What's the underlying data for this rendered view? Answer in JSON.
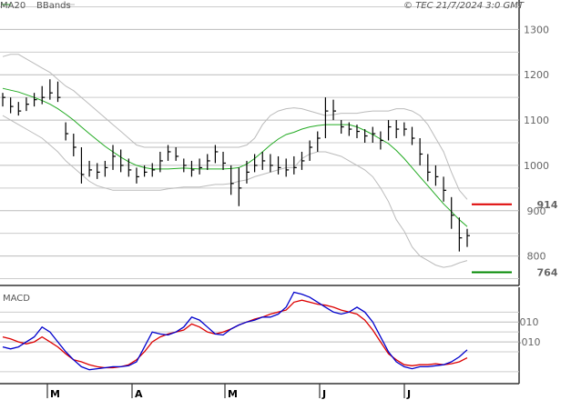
{
  "header": {
    "legend": [
      {
        "label": "MA20",
        "color": "#22aa22"
      },
      {
        "label": "BBands",
        "color": "#bbbbbb"
      }
    ],
    "copyright": "© TEC 21/7/2024 3:0 GMT"
  },
  "chart_data": [
    {
      "type": "line",
      "title": "",
      "ylim": [
        735,
        1365
      ],
      "yticks": [
        800,
        900,
        1000,
        1100,
        1200,
        1300
      ],
      "grid": true,
      "x_months": [
        "M",
        "A",
        "M",
        "J",
        "J"
      ],
      "levels": [
        {
          "label": "914",
          "value": 914,
          "color": "#dd0000"
        },
        {
          "label": "764",
          "value": 764,
          "color": "#008800"
        }
      ],
      "series": [
        {
          "name": "MA20",
          "color": "#22aa22",
          "values": [
            1170,
            1166,
            1162,
            1156,
            1150,
            1143,
            1135,
            1125,
            1113,
            1100,
            1085,
            1070,
            1056,
            1042,
            1030,
            1018,
            1008,
            1000,
            995,
            992,
            992,
            992,
            993,
            994,
            993,
            992,
            992,
            992,
            992,
            993,
            995,
            1003,
            1015,
            1030,
            1045,
            1058,
            1068,
            1073,
            1080,
            1085,
            1088,
            1090,
            1090,
            1090,
            1090,
            1085,
            1077,
            1068,
            1058,
            1048,
            1033,
            1015,
            995,
            975,
            955,
            935,
            915,
            898,
            880,
            865
          ]
        },
        {
          "name": "BBands",
          "color": "#bbbbbb",
          "values": [
            1240,
            1245,
            1245,
            1235,
            1225,
            1215,
            1205,
            1190,
            1175,
            1165,
            1150,
            1135,
            1120,
            1105,
            1090,
            1075,
            1060,
            1045,
            1040,
            1040,
            1040,
            1040,
            1040,
            1040,
            1040,
            1040,
            1040,
            1040,
            1040,
            1040,
            1040,
            1045,
            1060,
            1090,
            1110,
            1120,
            1125,
            1127,
            1125,
            1120,
            1115,
            1110,
            1112,
            1115,
            1115,
            1115,
            1118,
            1120,
            1120,
            1120,
            1125,
            1125,
            1120,
            1110,
            1090,
            1060,
            1030,
            985,
            945,
            925
          ]
        },
        {
          "values": [
            1110,
            1100,
            1090,
            1080,
            1070,
            1060,
            1045,
            1030,
            1010,
            995,
            980,
            965,
            955,
            950,
            945,
            945,
            945,
            945,
            945,
            945,
            945,
            948,
            950,
            952,
            952,
            952,
            955,
            958,
            958,
            960,
            965,
            968,
            975,
            980,
            985,
            990,
            995,
            995,
            1015,
            1025,
            1030,
            1030,
            1025,
            1020,
            1010,
            1000,
            990,
            975,
            950,
            920,
            880,
            855,
            820,
            800,
            790,
            780,
            775,
            778,
            785,
            790
          ]
        }
      ],
      "price_bars": [
        {
          "h": 1160,
          "l": 1130,
          "c": 1150
        },
        {
          "h": 1150,
          "l": 1115,
          "c": 1130
        },
        {
          "h": 1140,
          "l": 1110,
          "c": 1120
        },
        {
          "h": 1150,
          "l": 1120,
          "c": 1135
        },
        {
          "h": 1160,
          "l": 1130,
          "c": 1145
        },
        {
          "h": 1175,
          "l": 1135,
          "c": 1150
        },
        {
          "h": 1190,
          "l": 1145,
          "c": 1160
        },
        {
          "h": 1185,
          "l": 1140,
          "c": 1150
        },
        {
          "h": 1095,
          "l": 1055,
          "c": 1070
        },
        {
          "h": 1070,
          "l": 1020,
          "c": 1040
        },
        {
          "h": 1040,
          "l": 960,
          "c": 980
        },
        {
          "h": 1010,
          "l": 975,
          "c": 990
        },
        {
          "h": 1005,
          "l": 970,
          "c": 985
        },
        {
          "h": 1010,
          "l": 975,
          "c": 995
        },
        {
          "h": 1045,
          "l": 990,
          "c": 1020
        },
        {
          "h": 1035,
          "l": 985,
          "c": 1000
        },
        {
          "h": 1015,
          "l": 975,
          "c": 990
        },
        {
          "h": 995,
          "l": 960,
          "c": 975
        },
        {
          "h": 1000,
          "l": 975,
          "c": 985
        },
        {
          "h": 1005,
          "l": 975,
          "c": 990
        },
        {
          "h": 1030,
          "l": 985,
          "c": 1010
        },
        {
          "h": 1045,
          "l": 1010,
          "c": 1030
        },
        {
          "h": 1040,
          "l": 1010,
          "c": 1020
        },
        {
          "h": 1015,
          "l": 985,
          "c": 1000
        },
        {
          "h": 1010,
          "l": 975,
          "c": 990
        },
        {
          "h": 1015,
          "l": 980,
          "c": 995
        },
        {
          "h": 1025,
          "l": 990,
          "c": 1010
        },
        {
          "h": 1045,
          "l": 1005,
          "c": 1030
        },
        {
          "h": 1030,
          "l": 990,
          "c": 1005
        },
        {
          "h": 1000,
          "l": 935,
          "c": 960
        },
        {
          "h": 995,
          "l": 910,
          "c": 950
        },
        {
          "h": 1010,
          "l": 960,
          "c": 985
        },
        {
          "h": 1025,
          "l": 985,
          "c": 1000
        },
        {
          "h": 1030,
          "l": 990,
          "c": 1010
        },
        {
          "h": 1025,
          "l": 985,
          "c": 1000
        },
        {
          "h": 1020,
          "l": 980,
          "c": 995
        },
        {
          "h": 1015,
          "l": 975,
          "c": 990
        },
        {
          "h": 1020,
          "l": 980,
          "c": 995
        },
        {
          "h": 1030,
          "l": 990,
          "c": 1010
        },
        {
          "h": 1055,
          "l": 1010,
          "c": 1040
        },
        {
          "h": 1075,
          "l": 1030,
          "c": 1060
        },
        {
          "h": 1150,
          "l": 1060,
          "c": 1120
        },
        {
          "h": 1145,
          "l": 1100,
          "c": 1120
        },
        {
          "h": 1100,
          "l": 1070,
          "c": 1085
        },
        {
          "h": 1095,
          "l": 1065,
          "c": 1080
        },
        {
          "h": 1090,
          "l": 1060,
          "c": 1075
        },
        {
          "h": 1080,
          "l": 1050,
          "c": 1065
        },
        {
          "h": 1085,
          "l": 1050,
          "c": 1070
        },
        {
          "h": 1075,
          "l": 1035,
          "c": 1055
        },
        {
          "h": 1100,
          "l": 1055,
          "c": 1085
        },
        {
          "h": 1100,
          "l": 1060,
          "c": 1080
        },
        {
          "h": 1095,
          "l": 1065,
          "c": 1080
        },
        {
          "h": 1085,
          "l": 1045,
          "c": 1060
        },
        {
          "h": 1060,
          "l": 1000,
          "c": 1025
        },
        {
          "h": 1025,
          "l": 965,
          "c": 985
        },
        {
          "h": 1000,
          "l": 955,
          "c": 975
        },
        {
          "h": 975,
          "l": 920,
          "c": 945
        },
        {
          "h": 930,
          "l": 860,
          "c": 890
        },
        {
          "h": 885,
          "l": 810,
          "c": 840
        },
        {
          "h": 860,
          "l": 820,
          "c": 845
        }
      ]
    },
    {
      "type": "line",
      "title": "MACD",
      "ylim": [
        -52,
        45
      ],
      "yticks": [
        10,
        -10
      ],
      "ytick_labels": [
        "010",
        "-010"
      ],
      "grid": true,
      "series": [
        {
          "name": "MACD",
          "color": "#0000cc",
          "values": [
            -15,
            -17,
            -15,
            -10,
            -5,
            5,
            0,
            -10,
            -20,
            -28,
            -35,
            -38,
            -37,
            -36,
            -35,
            -35,
            -34,
            -30,
            -15,
            0,
            -2,
            -3,
            0,
            5,
            15,
            12,
            5,
            -2,
            -3,
            3,
            7,
            10,
            12,
            15,
            15,
            18,
            25,
            40,
            38,
            35,
            30,
            25,
            20,
            18,
            20,
            25,
            20,
            10,
            -5,
            -20,
            -30,
            -35,
            -37,
            -35,
            -35,
            -34,
            -33,
            -30,
            -25,
            -18
          ]
        },
        {
          "name": "Signal",
          "color": "#dd0000",
          "values": [
            -5,
            -7,
            -10,
            -12,
            -10,
            -5,
            -10,
            -15,
            -22,
            -28,
            -30,
            -33,
            -35,
            -36,
            -36,
            -35,
            -33,
            -28,
            -20,
            -10,
            -5,
            -2,
            0,
            2,
            8,
            5,
            0,
            -2,
            0,
            3,
            7,
            10,
            13,
            15,
            18,
            20,
            22,
            30,
            32,
            30,
            28,
            27,
            25,
            22,
            20,
            18,
            12,
            2,
            -10,
            -22,
            -28,
            -33,
            -34,
            -33,
            -33,
            -32,
            -33,
            -32,
            -30,
            -26
          ]
        }
      ]
    }
  ]
}
